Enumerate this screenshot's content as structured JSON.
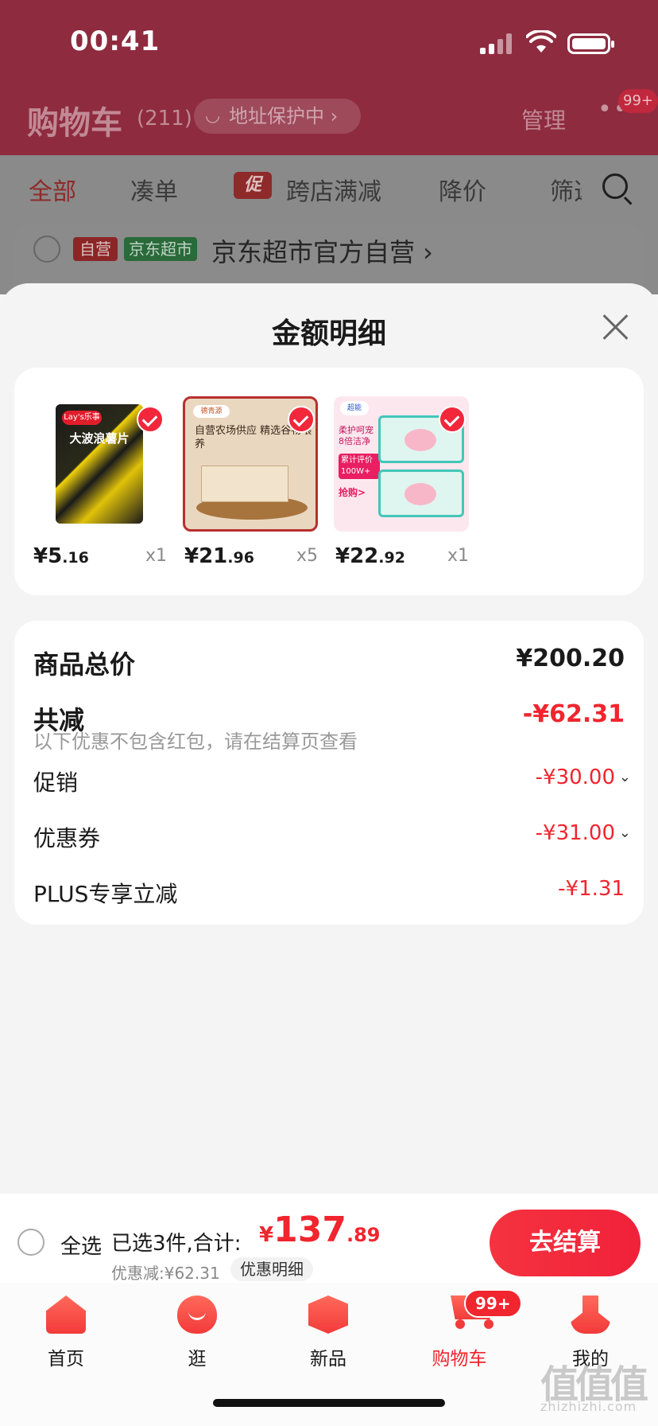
{
  "status_bar": {
    "time": "00:41"
  },
  "cart_header": {
    "title": "购物车",
    "count": "(211)",
    "address_protect": "地址保护中 ›",
    "manage": "管理",
    "more_badge": "99+"
  },
  "filter_tabs": {
    "all": "全部",
    "bundle": "凑单",
    "promo_tag": "促",
    "cross_store": "跨店满减",
    "price_drop": "降价",
    "filter": "筛选"
  },
  "store": {
    "tag_self": "自营",
    "tag_market": "京东超市",
    "name": "京东超市官方自营 ›"
  },
  "sheet": {
    "title": "金额明细",
    "products": [
      {
        "price_int": "¥5",
        "price_dec": ".16",
        "qty": "x1",
        "thumb_label": "Lay's乐事",
        "thumb_name": "大波浪薯片"
      },
      {
        "price_int": "¥21",
        "price_dec": ".96",
        "qty": "x5",
        "thumb_label": "德青源",
        "thumb_text": "自营农场供应 精选谷物喂养"
      },
      {
        "price_int": "¥22",
        "price_dec": ".92",
        "qty": "x1",
        "thumb_label": "超能",
        "thumb_text": "柔护呵宠 8倍洁净",
        "thumb_badge": "累计评价 100W+",
        "thumb_buy": "抢购>"
      }
    ],
    "summary": {
      "total_label": "商品总价",
      "total_value": "¥200.20",
      "reduce_label": "共减",
      "reduce_value": "-¥62.31",
      "hint": "以下优惠不包含红包，请在结算页查看",
      "promo_label": "促销",
      "promo_value": "-¥30.00",
      "coupon_label": "优惠券",
      "coupon_value": "-¥31.00",
      "plus_label": "PLUS专享立减",
      "plus_value": "-¥1.31"
    }
  },
  "checkout": {
    "select_all": "全选",
    "selected": "已选3件,合计:",
    "total_symbol": "¥",
    "total_int": "137",
    "total_dec": ".89",
    "discount": "优惠减:¥62.31",
    "detail_link": "优惠明细",
    "checkout_button": "去结算"
  },
  "tabbar": {
    "home": "首页",
    "guang": "逛",
    "new": "新品",
    "cart": "购物车",
    "cart_badge": "99+",
    "me": "我的"
  },
  "watermark": {
    "main": "值值值",
    "sub": "zhizhizhi.com"
  }
}
